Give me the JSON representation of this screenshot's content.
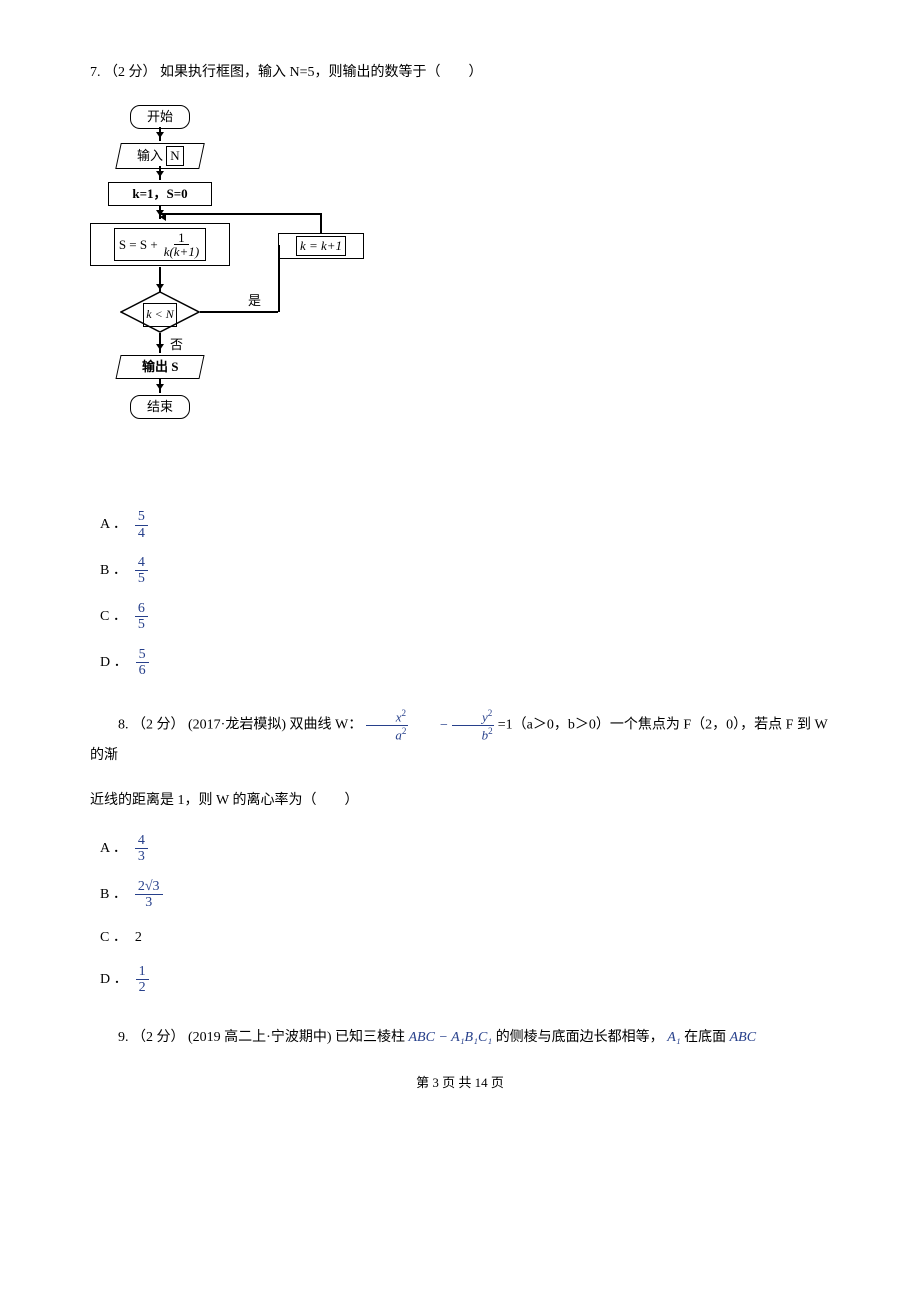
{
  "q7": {
    "num": "7.",
    "points": "（2 分）",
    "text": " 如果执行框图，输入 N=5，则输出的数等于（　　）",
    "flowchart": {
      "start": "开始",
      "input_label": "输入",
      "input_var": "N",
      "init": "k=1，S=0",
      "formula_lhs": "S = S +",
      "formula_num": "1",
      "formula_den": "k(k+1)",
      "increment": "k = k+1",
      "cond": "k < N",
      "yes": "是",
      "no": "否",
      "output": "输出 S",
      "end": "结束"
    },
    "choices": {
      "a_label": "A ．",
      "a_num": "5",
      "a_den": "4",
      "b_label": "B ．",
      "b_num": "4",
      "b_den": "5",
      "c_label": "C ．",
      "c_num": "6",
      "c_den": "5",
      "d_label": "D ．",
      "d_num": "5",
      "d_den": "6"
    }
  },
  "q8": {
    "prefix": "8. （2 分） (2017·龙岩模拟) 双曲线 W：",
    "x2": "x",
    "a2": "a",
    "y2": "y",
    "b2": "b",
    "suffix1": " =1（a＞0，b＞0）一个焦点为 F（2，0），若点 F 到 W 的渐",
    "suffix2": "近线的距离是 1，则 W 的离心率为（　　）",
    "choices": {
      "a_label": "A ．",
      "a_num": "4",
      "a_den": "3",
      "b_label": "B ．",
      "b_num": "2√3",
      "b_den": "3",
      "c_label": "C ．",
      "c_val": "2",
      "d_label": "D ．",
      "d_num": "1",
      "d_den": "2"
    }
  },
  "q9": {
    "prefix": "9. （2 分） (2019 高二上·宁波期中) 已知三棱柱 ",
    "prism_expr": "ABC − A₁B₁C₁",
    "mid": " 的侧棱与底面边长都相等， ",
    "point": "A₁",
    "suffix": " 在底面 ",
    "base": "ABC"
  },
  "footer": "第 3 页 共 14 页"
}
